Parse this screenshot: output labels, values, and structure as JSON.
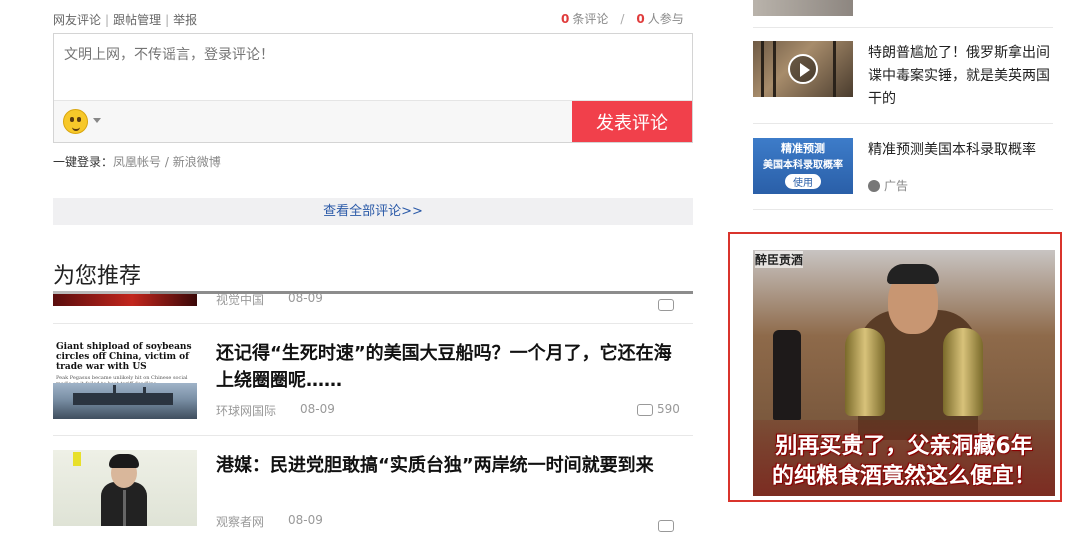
{
  "comments": {
    "toolbar": [
      "网友评论",
      "跟帖管理",
      "举报"
    ],
    "count_num": "0",
    "count_label": "条评论",
    "participants_num": "0",
    "participants_label": "人参与",
    "placeholder": "文明上网，不传谣言，登录评论！",
    "submit_label": "发表评论",
    "login_prefix": "一键登录：",
    "login_links": "凤凰帐号 / 新浪微博",
    "view_all": "查看全部评论>>"
  },
  "recommend": {
    "heading": "为您推荐",
    "items": [
      {
        "title": "",
        "source": "视觉中国",
        "date": "08-09",
        "comments": ""
      },
      {
        "title": "还记得“生死时速”的美国大豆船吗？一个月了，它还在海上绕圈圈呢……",
        "source": "环球网国际",
        "date": "08-09",
        "comments": "590",
        "thumb_headline": "Giant shipload of soybeans circles off China, victim of trade war with US",
        "thumb_sub": "Peak Pegasus became unlikely hit on Chinese social media as it failed to beat tariff deadline"
      },
      {
        "title": "港媒：民进党胆敢搞“实质台独”两岸统一时间就要到来",
        "source": "观察者网",
        "date": "08-09",
        "comments": ""
      }
    ]
  },
  "sidebar": {
    "items": [
      {
        "title": "特朗普尴尬了！俄罗斯拿出间谍中毒案实锤，就是美英两国干的"
      },
      {
        "title": "精准预测美国本科录取概率",
        "ad_label": "广告",
        "thumb_line1": "精准预测",
        "thumb_line2": "美国本科录取概率",
        "thumb_button": "使用"
      }
    ],
    "ad": {
      "brand": "醉臣贡酒",
      "headline_line1": "别再买贵了，父亲洞藏6年",
      "headline_line2": "的纯粮食酒竟然这么便宜！"
    }
  },
  "colors": {
    "accent_red": "#f1404b",
    "link_blue": "#2b5aa8",
    "ad_border": "#d9342c"
  }
}
